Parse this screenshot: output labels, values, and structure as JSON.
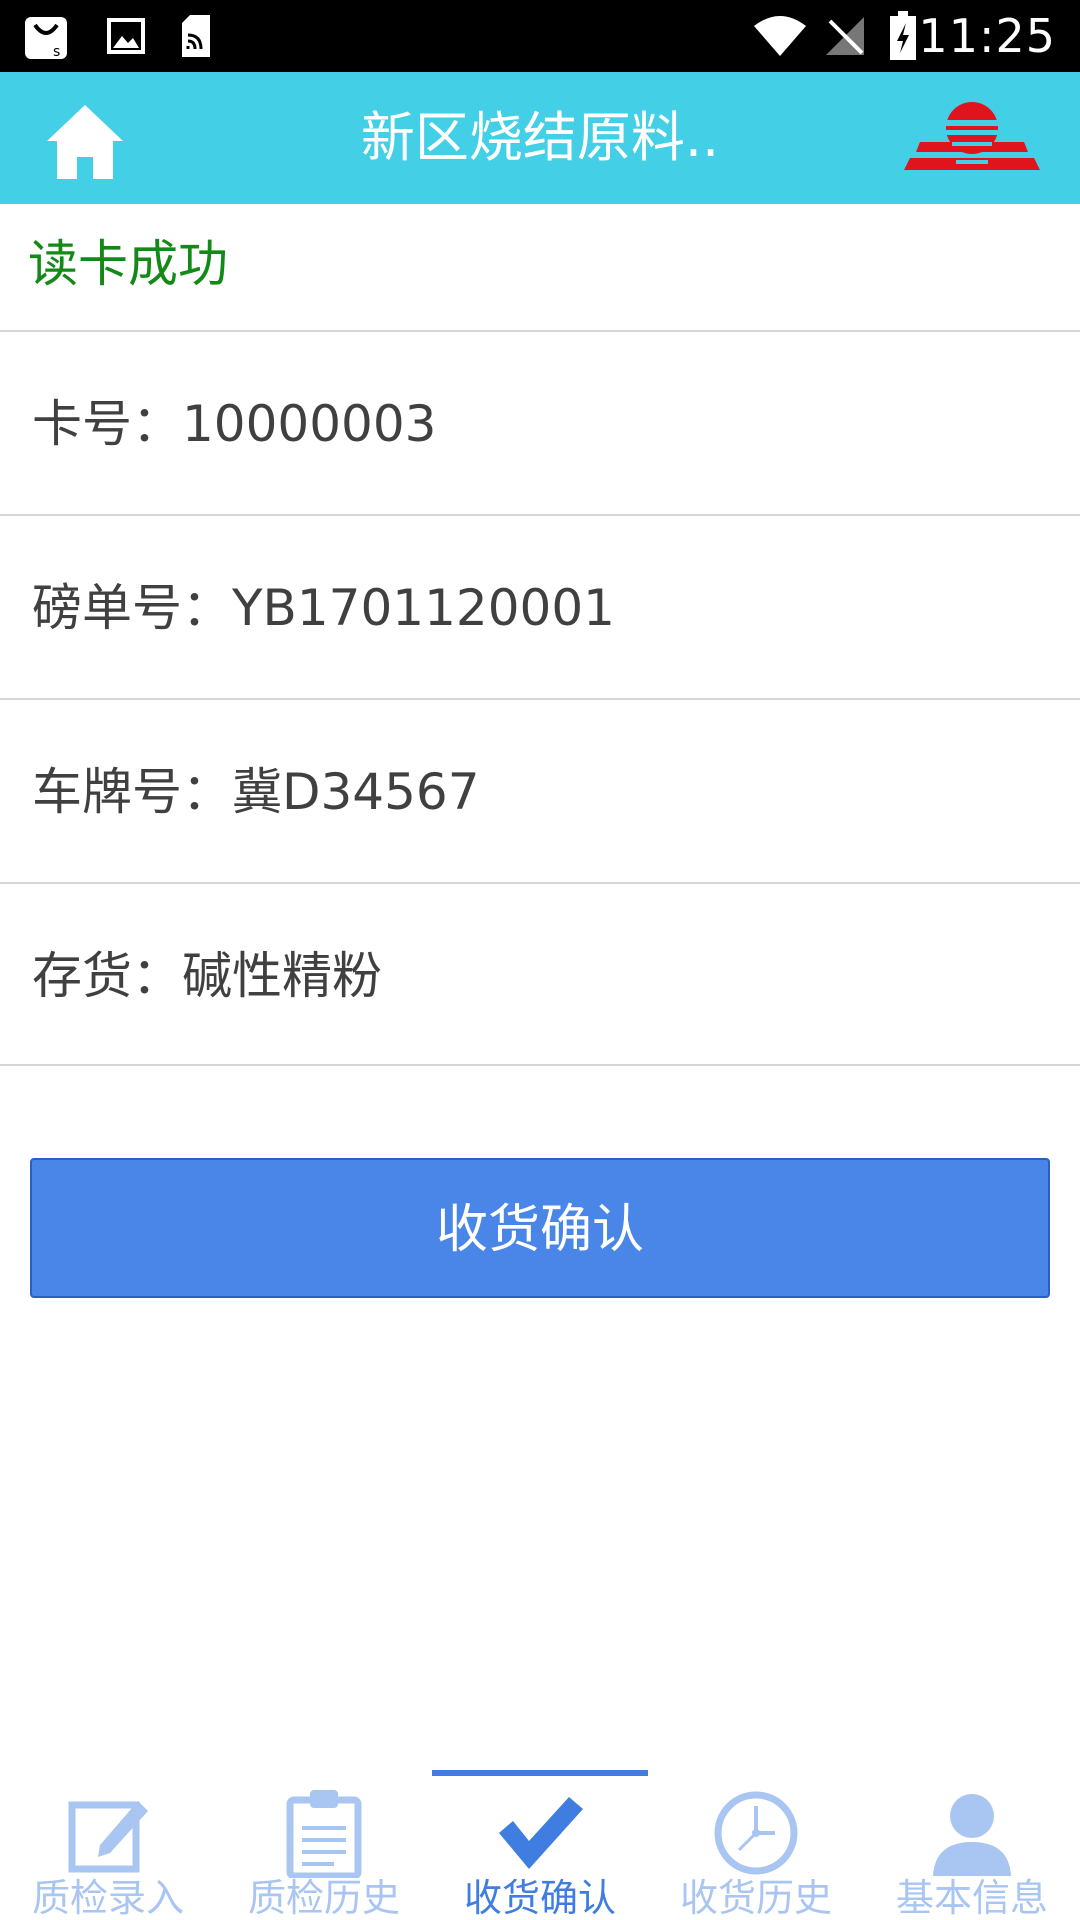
{
  "status_bar": {
    "time": "11:25",
    "left_icons": [
      "shopping-bag-icon",
      "image-icon",
      "sim-card-icon"
    ],
    "right_icons": [
      "wifi-icon",
      "no-signal-icon",
      "battery-charging-icon"
    ]
  },
  "header": {
    "title": "新区烧结原料..",
    "home_icon": "home-icon",
    "logo": "company-logo",
    "background": "#43CFE5"
  },
  "main": {
    "read_status": "读卡成功",
    "read_status_color": "#138A17",
    "fields": [
      {
        "text": "卡号：10000003"
      },
      {
        "text": "磅单号：YB1701120001"
      },
      {
        "text": "车牌号：冀D34567"
      },
      {
        "text": "存货：碱性精粉"
      }
    ],
    "confirm_button": "收货确认",
    "button_color": "#4A86E8"
  },
  "bottom_nav": {
    "active_index": 2,
    "active_color": "#3F7DE0",
    "inactive_color": "#A9C5F2",
    "items": [
      {
        "label": "质检录入",
        "icon": "edit-icon"
      },
      {
        "label": "质检历史",
        "icon": "clipboard-icon"
      },
      {
        "label": "收货确认",
        "icon": "checkmark-icon"
      },
      {
        "label": "收货历史",
        "icon": "clock-icon"
      },
      {
        "label": "基本信息",
        "icon": "user-icon"
      }
    ]
  }
}
